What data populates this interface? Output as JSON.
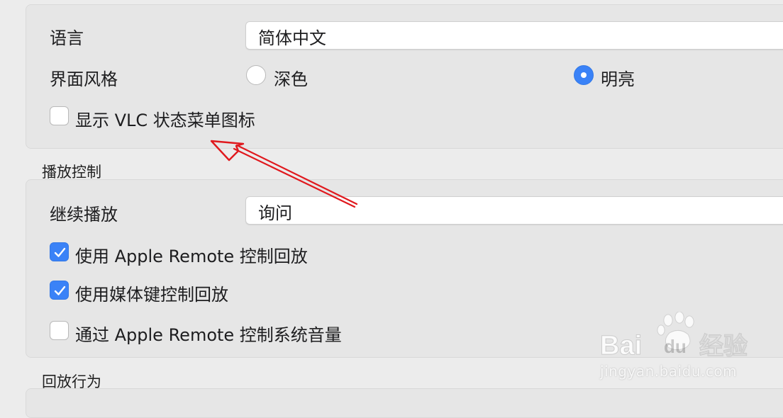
{
  "appearance": {
    "language_label": "语言",
    "language_value": "简体中文",
    "style_label": "界面风格",
    "style_options": [
      {
        "label": "深色",
        "selected": false
      },
      {
        "label": "明亮",
        "selected": true
      }
    ],
    "show_status_menu_icon": {
      "label": "显示 VLC 状态菜单图标",
      "checked": false
    }
  },
  "playback_control": {
    "title": "播放控制",
    "continue_label": "继续播放",
    "continue_value": "询问",
    "options": [
      {
        "label": "使用 Apple Remote 控制回放",
        "checked": true
      },
      {
        "label": "使用媒体键控制回放",
        "checked": true
      },
      {
        "label": "通过 Apple Remote 控制系统音量",
        "checked": false
      }
    ]
  },
  "playback_behavior": {
    "title": "回放行为"
  },
  "watermark": {
    "brand": "Baidu经验",
    "url": "jingyan.baidu.com"
  },
  "colors": {
    "accent": "#3a82f7",
    "annotation_arrow": "#e0191e"
  }
}
